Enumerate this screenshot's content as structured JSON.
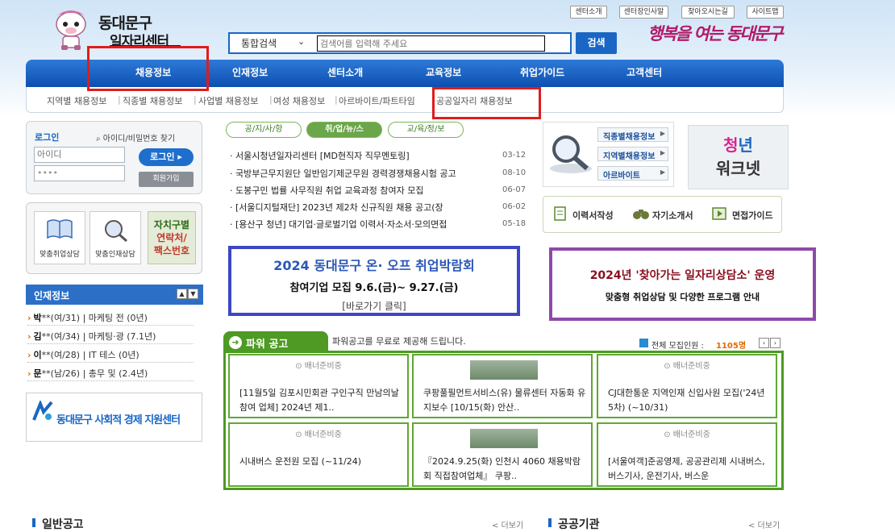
{
  "logo": {
    "line1": "동대문구",
    "line2": "일자리센터"
  },
  "search": {
    "select": "통합검색",
    "placeholder": "검색어를 입력해 주세요",
    "button": "검색"
  },
  "slogan": "행복을 여는 동대문구",
  "top_links": [
    "센터소개",
    "센터장인사말",
    "찾아오시는길",
    "사이트맵"
  ],
  "main_nav": [
    "채용정보",
    "인재정보",
    "센터소개",
    "교육정보",
    "취업가이드",
    "고객센터"
  ],
  "sub_nav": [
    "지역별 채용정보",
    "직종별 채용정보",
    "사업별 채용정보",
    "여성 채용정보",
    "아르바이트/파트타임",
    "공공일자리 채용정보"
  ],
  "login": {
    "title": "로그인",
    "find": "아이디/비밀번호 찾기",
    "id_placeholder": "아이디",
    "pw_value": "••••",
    "login_button": "로그인",
    "join_button": "회원가입"
  },
  "quick": {
    "item1": "맞춤취업상담",
    "item2": "맞춤인재상담",
    "local_l1": "자치구별",
    "local_l2": "연락처/",
    "local_l3": "팩스번호"
  },
  "talent": {
    "title": "인재정보",
    "rows": [
      {
        "name": "박",
        "info": "**(여/31) | 마케팅 전 (0년)"
      },
      {
        "name": "김",
        "info": "**(여/34) | 마케팅·광 (7.1년)"
      },
      {
        "name": "이",
        "info": "**(여/28) | IT 테스 (0년)"
      },
      {
        "name": "문",
        "info": "**(남/26) | 총무 및 (2.4년)"
      }
    ]
  },
  "social": "동대문구 사회적 경제 지원센터",
  "news": {
    "tabs": [
      "공/지/사/항",
      "취/업/뉴/스",
      "교/육/정/보"
    ],
    "items": [
      {
        "title": "· 서울시청년일자리센터 [MD현직자 직무멘토링]",
        "date": "03-12"
      },
      {
        "title": "· 국방부근무지원단 일반임기제군무원 경력경쟁채용시험 공고",
        "date": "08-10"
      },
      {
        "title": "· 도봉구민 법률 사무직원 취업 교육과정 참여자 모집",
        "date": "06-07"
      },
      {
        "title": "· [서울디지털재단] 2023년 제2차 신규직원 채용 공고(장",
        "date": "06-02"
      },
      {
        "title": "· [용산구 청년] 대기업·글로벌기업 이력서·자소서·모의면접",
        "date": "05-18"
      }
    ]
  },
  "categories": [
    "직종별채용정보",
    "지역별채용정보",
    "아르바이트"
  ],
  "youth": {
    "line1": "청년",
    "line2": "워크넷"
  },
  "services": [
    "이력서작성",
    "자기소개서",
    "면접가이드"
  ],
  "banner1": {
    "line1": "2024 동대문구 온· 오프 취업박람회",
    "line2": "참여기업 모집 9.6.(금)~ 9.27.(금)",
    "line3": "[바로가기 클릭]"
  },
  "banner2": {
    "line1": "2024년 '찾아가는 일자리상담소' 운영",
    "line2": "맞춤형 취업상담 및 다양한 프로그램 안내"
  },
  "power": {
    "title": "파워 공고",
    "desc": "파워공고를 무료로 제공해 드립니다.",
    "count_label": "전체 모집인원 :",
    "count_value": "1105명",
    "placeholder": "배너준비중",
    "cards": [
      "[11월5일 김포시민회관 구인구직 만남의날 참여 업체] 2024년 제1..",
      "쿠팡풀필먼트서비스(유) 물류센터 자동화 유지보수 [10/15(화) 안산..",
      "CJ대한통운 지역인재 신입사원 모집('24년 5차) (~10/31)",
      "시내버스 운전원 모집 (~11/24)",
      "『2024.9.25(화) 인천시 4060 채용박람회 직접참여업체』 쿠팡..",
      "[서울여객]준공영제, 공공관리제 시내버스, 버스기사, 운전기사, 버스운"
    ]
  },
  "bottom": {
    "general": "일반공고",
    "public": "공공기관",
    "more": "< 더보기"
  }
}
